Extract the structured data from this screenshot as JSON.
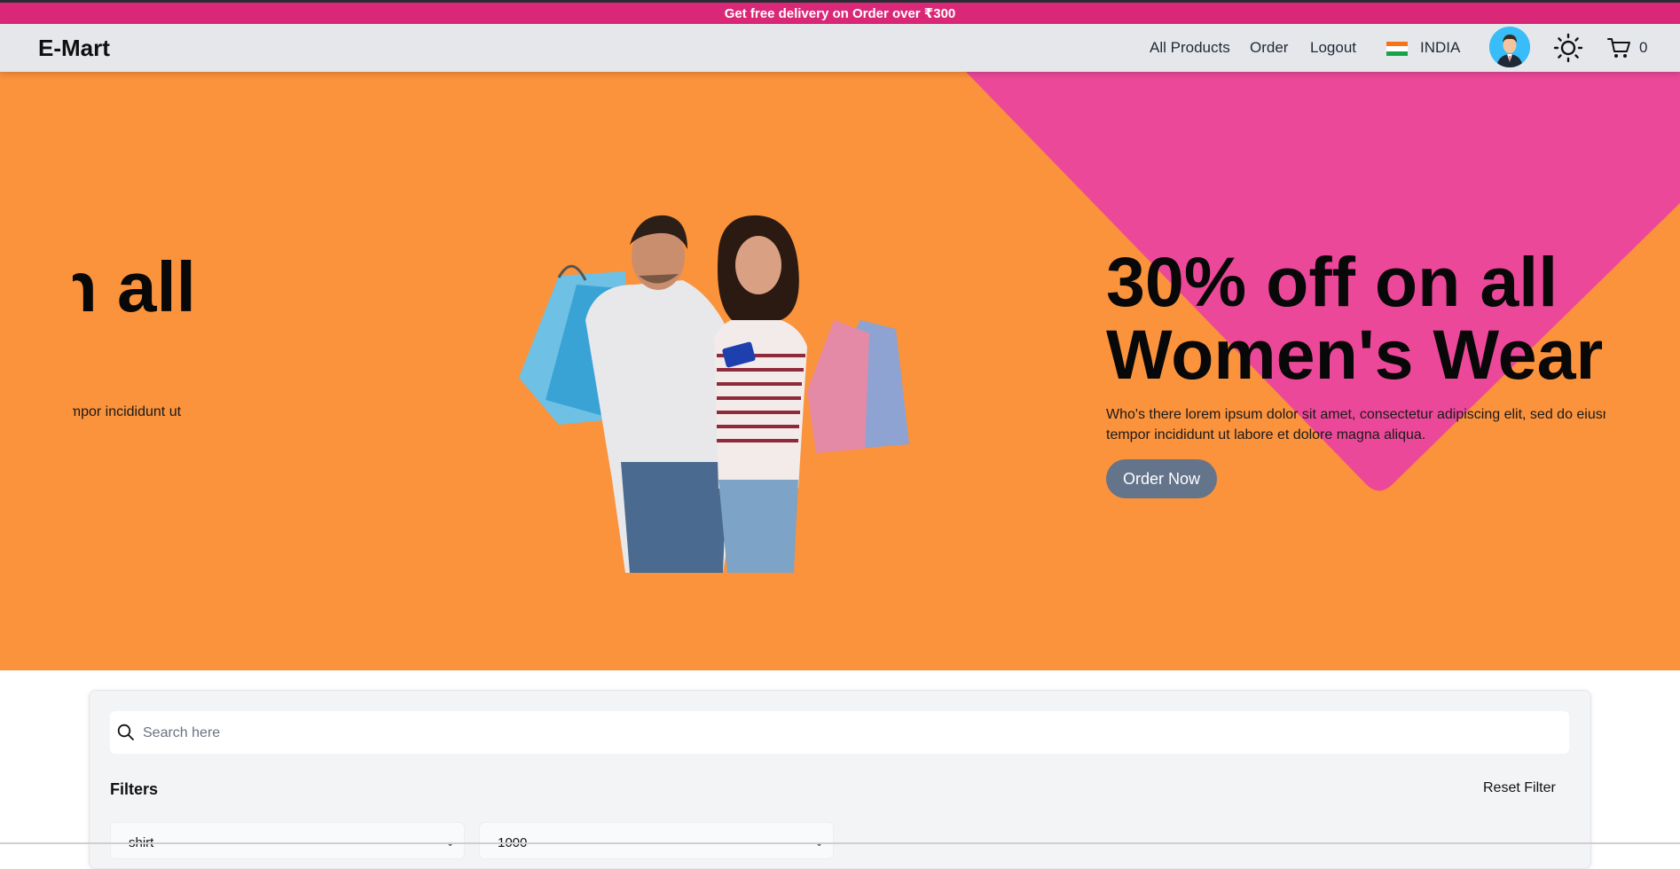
{
  "promo": {
    "text": "Get free delivery on Order over ₹300"
  },
  "navbar": {
    "logo": "E-Mart",
    "links": [
      "All Products",
      "Order",
      "Logout"
    ],
    "country": "INDIA",
    "cart_count": "0",
    "icons": {
      "theme": "sun-icon",
      "cart": "cart-icon",
      "avatar": "user-avatar",
      "flag": "india-flag-icon"
    }
  },
  "hero": {
    "previous_slide": {
      "title_fragment": "on all",
      "desc_fragment": "sed do eiusmod tempor incididunt ut"
    },
    "current_slide": {
      "title_line1": "30% off on all",
      "title_line2": "Women's Wear",
      "description": "Who's there lorem ipsum dolor sit amet, consectetur adipiscing elit, sed do eiusmod tempor incididunt ut labore et dolore magna aliqua.",
      "button": "Order Now"
    },
    "colors": {
      "background": "#fb923c",
      "accent": "#ec4899"
    }
  },
  "filters": {
    "search_placeholder": "Search here",
    "title": "Filters",
    "reset": "Reset Filter",
    "selects": [
      "shirt",
      "1000"
    ]
  },
  "colors": {
    "promo": "#db2777",
    "navbar": "#e5e7eb",
    "button": "#64748b"
  }
}
